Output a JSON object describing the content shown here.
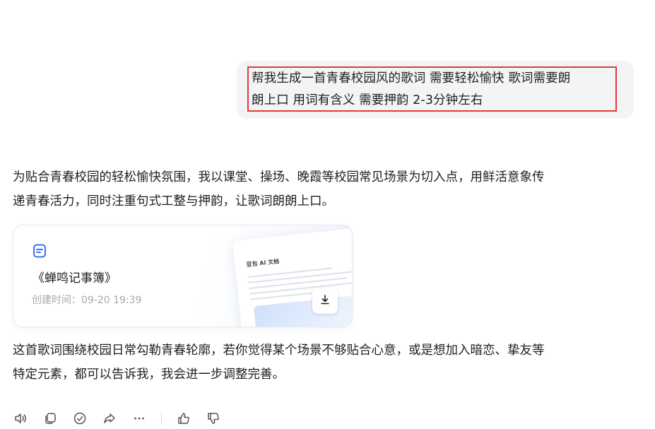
{
  "user_message": {
    "line1": "帮我生成一首青春校园风的歌词 需要轻松愉快 歌词需要朗",
    "line2": "朗上口 用词有含义 需要押韵 2-3分钟左右"
  },
  "assistant": {
    "intro_line1": "为贴合青春校园的轻松愉快氛围，我以课堂、操场、晚霞等校园常见场景为切入点，用鲜活意象传",
    "intro_line2": "递青春活力，同时注重句式工整与押韵，让歌词朗朗上口。",
    "document": {
      "title": "《蝉鸣记事簿》",
      "created_time": "创建时间：09-20 19:39",
      "preview_label": "豆包 AI 文档",
      "icon": "document-icon",
      "download_icon": "download-icon"
    },
    "outro_line1": "这首歌词围绕校园日常勾勒青春轮廓，若你觉得某个场景不够贴合心意，或是想加入暗恋、挚友等",
    "outro_line2": "特定元素，都可以告诉我，我会进一步调整完善。"
  },
  "actions": {
    "icons": [
      "speaker-icon",
      "copy-icon",
      "check-circle-icon",
      "share-icon",
      "more-icon",
      "thumbs-up-icon",
      "thumbs-down-icon"
    ]
  },
  "colors": {
    "highlight_border": "#e53935",
    "bubble_bg": "#f3f4f6",
    "accent_blue": "#3b6ff5",
    "muted_text": "#a6a9b0"
  }
}
